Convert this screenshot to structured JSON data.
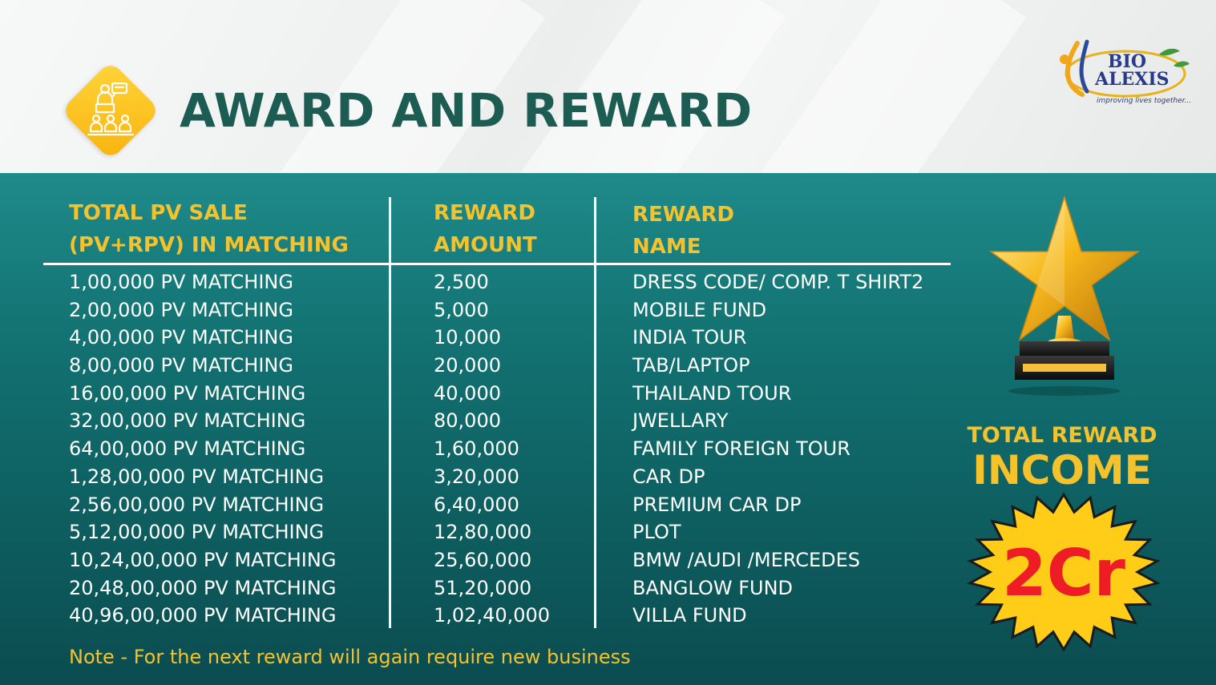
{
  "header": {
    "title": "AWARD AND REWARD",
    "logo": {
      "line1": "BIO",
      "line2": "ALEXIS",
      "tagline": "improving lives together..."
    }
  },
  "table": {
    "headers": {
      "col1_line1": "TOTAL PV SALE",
      "col1_line2": "(PV+RPV) IN MATCHING",
      "col2_line1": "REWARD",
      "col2_line2": "AMOUNT",
      "col3_line1": "REWARD",
      "col3_line2": "NAME"
    },
    "rows": [
      {
        "pv": "1,00,000 PV MATCHING",
        "amount": "2,500",
        "name": "DRESS CODE/ COMP. T SHIRT2"
      },
      {
        "pv": "2,00,000 PV MATCHING",
        "amount": "5,000",
        "name": "MOBILE FUND"
      },
      {
        "pv": "4,00,000 PV MATCHING",
        "amount": "10,000",
        "name": "INDIA TOUR"
      },
      {
        "pv": "8,00,000 PV MATCHING",
        "amount": "20,000",
        "name": "TAB/LAPTOP"
      },
      {
        "pv": "16,00,000 PV MATCHING",
        "amount": "40,000",
        "name": "THAILAND TOUR"
      },
      {
        "pv": "32,00,000 PV MATCHING",
        "amount": "80,000",
        "name": "JWELLARY"
      },
      {
        "pv": "64,00,000 PV MATCHING",
        "amount": "1,60,000",
        "name": "FAMILY FOREIGN TOUR"
      },
      {
        "pv": "1,28,00,000 PV MATCHING",
        "amount": "3,20,000",
        "name": "CAR DP"
      },
      {
        "pv": "2,56,00,000 PV MATCHING",
        "amount": "6,40,000",
        "name": "PREMIUM CAR DP"
      },
      {
        "pv": "5,12,00,000 PV MATCHING",
        "amount": "12,80,000",
        "name": "PLOT"
      },
      {
        "pv": "10,24,00,000 PV MATCHING",
        "amount": "25,60,000",
        "name": "BMW /AUDI /MERCEDES"
      },
      {
        "pv": "20,48,00,000 PV MATCHING",
        "amount": "51,20,000",
        "name": "BANGLOW FUND"
      },
      {
        "pv": "40,96,00,000 PV MATCHING",
        "amount": "1,02,40,000",
        "name": "VILLA FUND"
      }
    ]
  },
  "note": "Note - For the next reward will again require new business",
  "total_reward": {
    "label": "TOTAL REWARD",
    "income": "INCOME",
    "value": "2Cr"
  },
  "colors": {
    "accent_yellow": "#f6c22c",
    "title_green": "#1c5c52",
    "panel_teal": "#127070",
    "value_red": "#ee1c24"
  },
  "icons": {
    "header": "presentation-audience-icon",
    "trophy": "star-trophy-icon",
    "burst": "starburst-badge"
  }
}
